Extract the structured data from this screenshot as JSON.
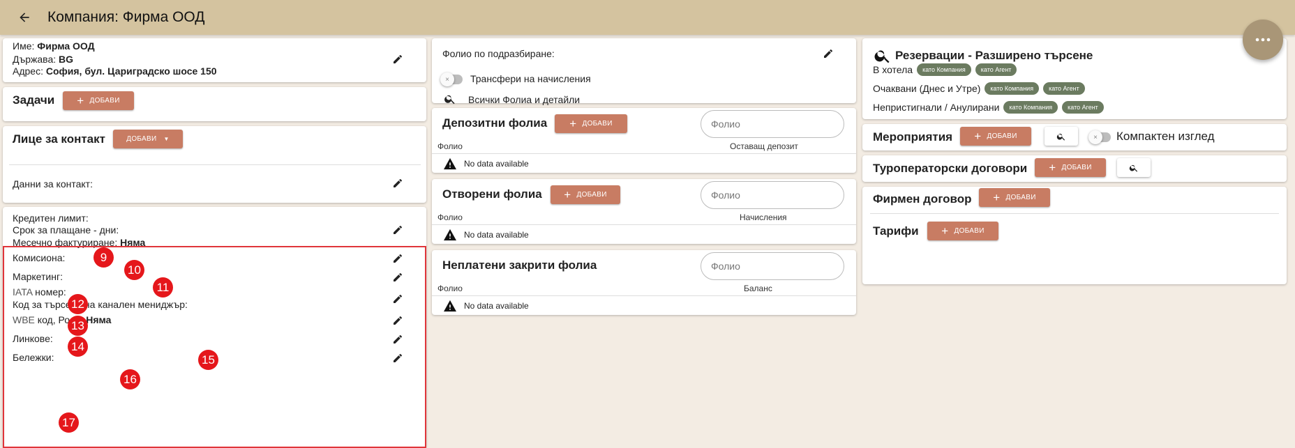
{
  "appbar": {
    "title": "Компания: Фирма ООД"
  },
  "company": {
    "name_label": "Име:",
    "name_value": "Фирма ООД",
    "country_label": "Държава:",
    "country_value": "BG",
    "address_label": "Адрес:",
    "address_value": "София, бул. Цариградско шосе 150"
  },
  "tasks": {
    "title": "Задачи",
    "add_label": "ДОБАВИ"
  },
  "contact": {
    "title": "Лице за контакт",
    "add_label": "ДОБАВИ",
    "data_label": "Данни за контакт:"
  },
  "details": {
    "credit_limit": "Кредитен лимит:",
    "payment_term": "Срок за плащане - дни:",
    "monthly_billing_label": "Месечно фактуриране:",
    "monthly_billing_value": "Няма",
    "commission": "Комисиона:",
    "marketing": "Маркетинг:",
    "iata_prefix": "IATA",
    "iata_suffix": "номер:",
    "channel_manager": "Код за търсене на канален мениджър:",
    "wbe_prefix": "WBE",
    "wbe_suffix": "код, Роля:",
    "wbe_value": "Няма",
    "links": "Линкове:",
    "notes": "Бележки:"
  },
  "badges": [
    "9",
    "10",
    "11",
    "12",
    "13",
    "14",
    "15",
    "16",
    "17"
  ],
  "folio": {
    "default_label": "Фолио по подразбиране:",
    "transfer_label": "Трансфери на начисления",
    "all_folios_label": "Всички Фолиа и детайли"
  },
  "deposit": {
    "title": "Депозитни фолиа",
    "add_label": "ДОБАВИ",
    "search_placeholder": "Фолио",
    "col1": "Фолио",
    "col2": "Оставащ депозит",
    "nodata": "No data available"
  },
  "open": {
    "title": "Отворени фолиа",
    "add_label": "ДОБАВИ",
    "search_placeholder": "Фолио",
    "col1": "Фолио",
    "col2": "Начисления",
    "nodata": "No data available"
  },
  "unpaid": {
    "title": "Неплатени закрити фолиа",
    "search_placeholder": "Фолио",
    "col1": "Фолио",
    "col2": "Баланс",
    "nodata": "No data available"
  },
  "reservations": {
    "title": "Резервации - Разширено търсене",
    "rows": [
      {
        "label": "В хотела",
        "chip1": "като Компания",
        "chip2": "като Агент"
      },
      {
        "label": "Очаквани (Днес и Утре)",
        "chip1": "като Компания",
        "chip2": "като Агент"
      },
      {
        "label": "Непристигнали / Анулирани",
        "chip1": "като Компания",
        "chip2": "като Агент"
      }
    ]
  },
  "events": {
    "title": "Мероприятия",
    "add_label": "ДОБАВИ",
    "compact_label": "Компактен изглед"
  },
  "tour": {
    "title": "Туроператорски договори",
    "add_label": "ДОБАВИ"
  },
  "contract": {
    "title": "Фирмен договор",
    "add_label": "ДОБАВИ"
  },
  "tariffs": {
    "title": "Тарифи",
    "add_label": "ДОБАВИ"
  },
  "colors": {
    "appbar": "#d4c39f",
    "accent": "#c87c63",
    "chip": "#6b7b60",
    "badge": "#e5171b",
    "background": "#f3ece3"
  }
}
